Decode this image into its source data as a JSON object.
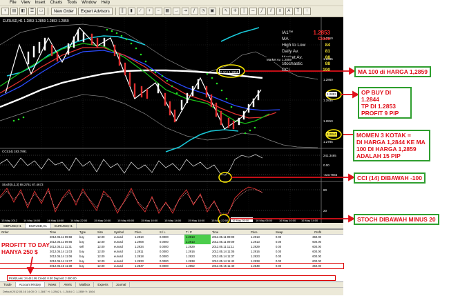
{
  "menu": [
    "File",
    "View",
    "Insert",
    "Charts",
    "Tools",
    "Window",
    "Help"
  ],
  "toolbar": {
    "new_order": "New Order",
    "expert_advisors": "Expert Advisors"
  },
  "chart": {
    "title": "EURUSD,H1  1.2853 1.2859 1.2853 1.2859",
    "table": [
      {
        "k": "IA1™",
        "v": "1.2853",
        "head": true
      },
      {
        "k": "MA",
        "v": "Close",
        "red": true
      },
      {
        "k": "High to Low",
        "v": "84"
      },
      {
        "k": "Daily Av.",
        "v": "81"
      },
      {
        "k": "Market Av.",
        "v": "88"
      },
      {
        "k": "Stochastic",
        "v": "88"
      },
      {
        "k": "CCI",
        "v": "190"
      }
    ],
    "price_labels": [
      "1.2910",
      "1.2885",
      "1.2860",
      "1.2835",
      "1.2810",
      "1.2785"
    ],
    "ma_tag": "0.10 / 1.2859",
    "market_tag": "Market Av. 1.2859",
    "buy_tag": "1.2853",
    "sl_tag": "1.2844",
    "cci_label": "CCI(14) 183.7891",
    "cci_levels": [
      "241.3465",
      "0.00",
      "-223.7945"
    ],
    "stoch_label": "Stoch(5,3,3) 88.2761 87.4673",
    "stoch_levels": [
      "80",
      "20"
    ],
    "time_labels": [
      "13 May 2012",
      "14 May 14:00",
      "14 May 18:00",
      "14 May 22:00",
      "15 May 02:00",
      "15 May 06:00",
      "15 May 10:00",
      "15 May 14:00",
      "15 May 18:00",
      "15 May 22:00",
      "16 May 02:00",
      "16 May 06:00",
      "16 May 10:00",
      "16 May 14:00"
    ],
    "cursor_time": "16 May 05:00"
  },
  "chart_tabs": [
    "GBPUSD,H1",
    "EURUSD,H1",
    "EURUSD,H1"
  ],
  "terminal": {
    "headers": [
      "Order",
      "Time",
      "Type",
      "Size",
      "Symbol",
      "Price",
      "S / L",
      "T / P",
      "Time",
      "Price",
      "Swap",
      "Profit"
    ],
    "rows": [
      [
        "",
        "2012.05.11 09:68",
        "buy",
        "12.00",
        "eurusd",
        "1.2910",
        "0.0000",
        "1.2913",
        "2012.05.11 09:09",
        "1.2913",
        "0.00",
        "360.00"
      ],
      [
        "",
        "2012.05.11 09:66",
        "buy",
        "12.00",
        "eurusd",
        "1.2908",
        "0.0000",
        "1.2913",
        "2012.05.11 09:09",
        "1.2913",
        "0.00",
        "600.00"
      ],
      [
        "",
        "2012.05.11 11:31",
        "sell",
        "12.00",
        "eurusd",
        "1.2934",
        "0.0000",
        "1.2929",
        "2012.05.11 11:11",
        "1.2929",
        "0.00",
        "600.00"
      ],
      [
        "",
        "2012.05.14 11:03",
        "buy",
        "12.00",
        "eurusd",
        "1.2911",
        "0.0000",
        "1.2916",
        "2012.05.14 11:05",
        "1.2916",
        "0.00",
        "600.00"
      ],
      [
        "",
        "2012.05.14 11:06",
        "buy",
        "12.00",
        "eurusd",
        "1.2918",
        "0.0000",
        "1.2923",
        "2012.05.14 11:37",
        "1.2923",
        "0.00",
        "600.00"
      ],
      [
        "",
        "2012.05.14 11:37",
        "buy",
        "12.00",
        "eurusd",
        "1.2933",
        "0.0000",
        "1.2938",
        "2012.05.14 11:42",
        "1.2938",
        "0.00",
        "600.00"
      ],
      [
        "",
        "2012.05.15 11:38",
        "buy",
        "12.00",
        "eurusd",
        "1.2847",
        "0.0000",
        "1.2852",
        "2012.05.15 11:40",
        "1.2849",
        "0.00",
        "250.00"
      ]
    ],
    "summary": "Profit/Loss: 24 441.95  Credit: 0.00  Deposit: 2 000.00"
  },
  "bottom_tabs": [
    "Trade",
    "Account History",
    "News",
    "Alerts",
    "Mailbox",
    "Experts",
    "Journal"
  ],
  "status_bar": "Default      2012.05.16 14:00   O: 1.2847   H: 1.2862   L: 1.2844   C: 1.2859   V: 1804",
  "annotations": {
    "ma100": "MA 100 di HARGA 1,2859",
    "op_buy": [
      "OP BUY DI 1.2844",
      "TP DI 1.2853",
      "PROFIT 9 PIP"
    ],
    "momen": [
      "MOMEN 3 KOTAK =",
      "DI HARGA 1,2844 KE MA",
      "100 DI HARGA 1,2859",
      "ADALAH 15 PIP"
    ],
    "cci": "CCI (14) DIBAWAH -100",
    "stoch": "STOCH DIBAWAH MINUS 20",
    "profit": [
      "PROFITT TO DAY",
      "HANYA 250 $"
    ]
  },
  "colors": {
    "annotation_red": "#e0101a",
    "annotation_green": "#2e9e2e",
    "bull": "#ffffff",
    "bear": "#e03030",
    "chart_bg": "#000000"
  }
}
